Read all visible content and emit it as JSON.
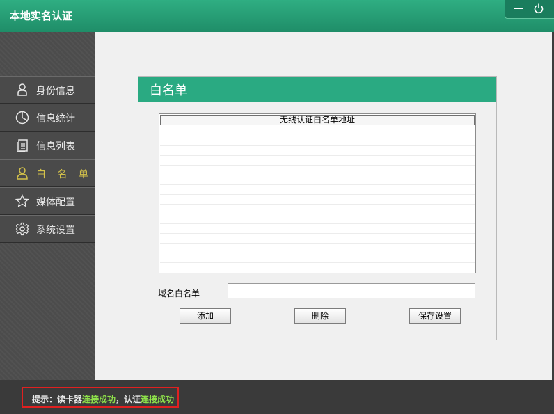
{
  "app": {
    "title": "本地实名认证"
  },
  "window_controls": {
    "minimize_icon": "minimize-icon",
    "power_icon": "power-icon"
  },
  "sidebar": {
    "items": [
      {
        "label": "身份信息",
        "icon": "person-icon"
      },
      {
        "label": "信息统计",
        "icon": "pie-chart-icon"
      },
      {
        "label": "信息列表",
        "icon": "document-list-icon"
      },
      {
        "label": "白 名 单",
        "icon": "user-outline-icon",
        "active": true
      },
      {
        "label": "媒体配置",
        "icon": "star-icon"
      },
      {
        "label": "系统设置",
        "icon": "gear-icon"
      }
    ],
    "active_color": "#d4c24a"
  },
  "panel": {
    "title": "白名单",
    "accent_color": "#2aaa82",
    "list": {
      "column_header": "无线认证白名单地址",
      "rows": []
    },
    "domain_label": "域名白名单",
    "domain_value": "",
    "buttons": {
      "add": "添加",
      "delete": "删除",
      "save": "保存设置"
    }
  },
  "status": {
    "prefix": "提示：读卡器",
    "reader_status": "连接成功",
    "middle": "，认证",
    "auth_status": "连接成功",
    "ok_color": "#8ee04a"
  }
}
